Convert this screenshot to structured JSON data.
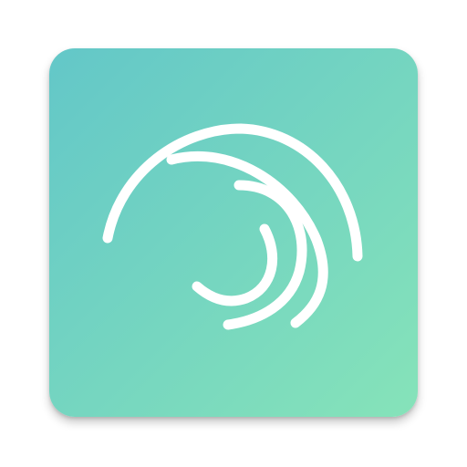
{
  "app_icon": {
    "name": "swirl-logo",
    "gradient_start": "#63c7c8",
    "gradient_end": "#86e3b9",
    "glyph_color": "#ffffff",
    "page_background": "#ffffff"
  }
}
